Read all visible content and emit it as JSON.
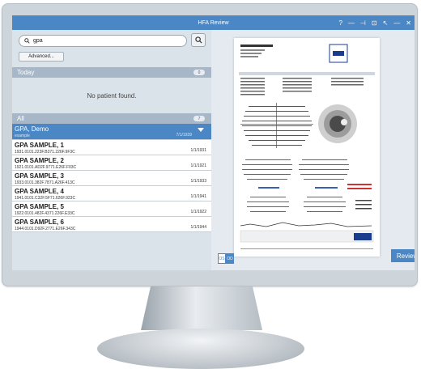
{
  "window": {
    "title": "HFA Review",
    "controls": [
      "?",
      "—",
      "⊣",
      "⊡",
      "↖",
      "—",
      "✕"
    ]
  },
  "search": {
    "value": "gpa",
    "advanced_label": "Advanced..."
  },
  "today": {
    "label": "Today",
    "count": "0",
    "empty_text": "No patient found."
  },
  "all": {
    "label": "All",
    "count": "7"
  },
  "patients": [
    {
      "name": "GPA, Demo",
      "id": "example",
      "date": "7/1/1939"
    },
    {
      "name": "GPA SAMPLE, 1",
      "id": "1931.0101.223F.B371.226F.9F3C",
      "date": "1/1/1931"
    },
    {
      "name": "GPA SAMPLE, 2",
      "id": "1921.0101.AD2F.9771.E26F.F03C",
      "date": "1/1/1921"
    },
    {
      "name": "GPA SAMPLE, 3",
      "id": "1933.0101.382F.7871.A26F.413C",
      "date": "1/1/1933"
    },
    {
      "name": "GPA SAMPLE, 4",
      "id": "1941.0101.C32F.5F71.626F.923C",
      "date": "1/1/1941"
    },
    {
      "name": "GPA SAMPLE, 5",
      "id": "1922.0101.482F.4371.226F.E33C",
      "date": "1/1/1922"
    },
    {
      "name": "GPA SAMPLE, 6",
      "id": "1944.0101.D92F.2771.E26F.343C",
      "date": "1/1/1944"
    }
  ],
  "report": {
    "name": "GPA, Demo",
    "brand": "ZEISS",
    "test": "Single Field Analysis",
    "pattern": "Central 30-2 Threshold Test",
    "total_dev": "Total Deviation",
    "pattern_dev": "Pattern Deviation"
  },
  "eyes": {
    "os": "OS",
    "od": "OD"
  },
  "review_label": "Review"
}
